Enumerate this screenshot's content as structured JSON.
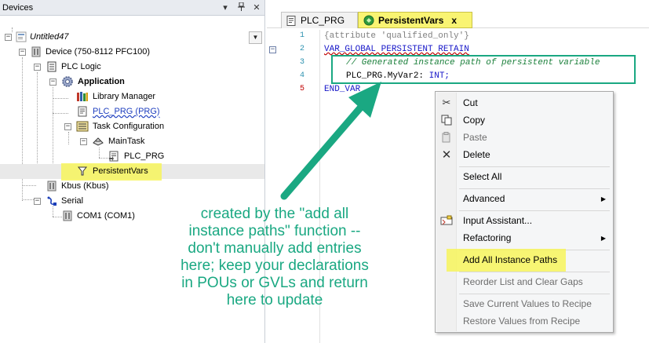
{
  "devices_panel": {
    "title": "Devices",
    "pin_glyph": "⮟",
    "pin_glyph2": "\u0002",
    "tree": [
      {
        "label": "Untitled47",
        "style": "italic",
        "icon": "project-icon"
      },
      {
        "label": "Device (750-8112 PFC100)",
        "icon": "device-icon"
      },
      {
        "label": "PLC Logic",
        "icon": "plc-logic-icon"
      },
      {
        "label": "Application",
        "style": "bold",
        "icon": "application-gear-icon"
      },
      {
        "label": "Library Manager",
        "icon": "library-manager-icon"
      },
      {
        "label": "PLC_PRG (PRG)",
        "style": "link",
        "icon": "pou-icon"
      },
      {
        "label": "Task Configuration",
        "icon": "task-configuration-icon"
      },
      {
        "label": "MainTask",
        "icon": "main-task-icon"
      },
      {
        "label": "PLC_PRG",
        "icon": "pou-call-icon"
      },
      {
        "label": "PersistentVars",
        "icon": "persistent-vars-icon"
      },
      {
        "label": "Kbus (Kbus)",
        "icon": "kbus-icon"
      },
      {
        "label": "Serial",
        "icon": "serial-icon"
      },
      {
        "label": "COM1 (COM1)",
        "icon": "com-port-icon"
      }
    ]
  },
  "editor": {
    "tabs": [
      {
        "label": "PLC_PRG",
        "active": false
      },
      {
        "label": "PersistentVars",
        "active": true,
        "close": "x"
      }
    ],
    "line_numbers": [
      "1",
      "2",
      "3",
      "4",
      "5"
    ],
    "code": {
      "line1": "{attribute 'qualified_only'}",
      "line2": "VAR_GLOBAL PERSISTENT RETAIN",
      "line3": "// Generated instance path of persistent variable",
      "line4_var": "PLC_PRG.MyVar2: ",
      "line4_type": "INT;",
      "line5": "END_VAR"
    }
  },
  "context_menu": {
    "items": [
      {
        "label": "Cut",
        "icon": "scissors-icon",
        "enabled": true
      },
      {
        "label": "Copy",
        "icon": "copy-icon",
        "enabled": true
      },
      {
        "label": "Paste",
        "icon": "paste-icon",
        "enabled": false
      },
      {
        "label": "Delete",
        "icon": "delete-x-icon",
        "enabled": true
      },
      {
        "label": "Select All",
        "enabled": true
      },
      {
        "label": "Advanced",
        "submenu": true,
        "enabled": true
      },
      {
        "label": "Input Assistant...",
        "icon": "input-assistant-icon",
        "enabled": true
      },
      {
        "label": "Refactoring",
        "submenu": true,
        "enabled": true
      },
      {
        "label": "Add All Instance Paths",
        "enabled": true,
        "highlighted": true
      },
      {
        "label": "Reorder List and Clear Gaps",
        "enabled": false
      },
      {
        "label": "Save Current Values to Recipe",
        "enabled": false
      },
      {
        "label": "Restore Values from Recipe",
        "enabled": false
      }
    ]
  },
  "annotation": {
    "lines": [
      "created by the \"add all",
      "instance paths\" function --",
      "don't manually add entries",
      "here; keep your declarations",
      "in POUs or GVLs and return",
      "here to update"
    ]
  },
  "colors": {
    "annotation": "#1aa882",
    "highlight_yellow": "#f7f45c",
    "active_tab": "#f9f472",
    "keyword": "#1616c8",
    "comment": "#1a7f3a"
  }
}
